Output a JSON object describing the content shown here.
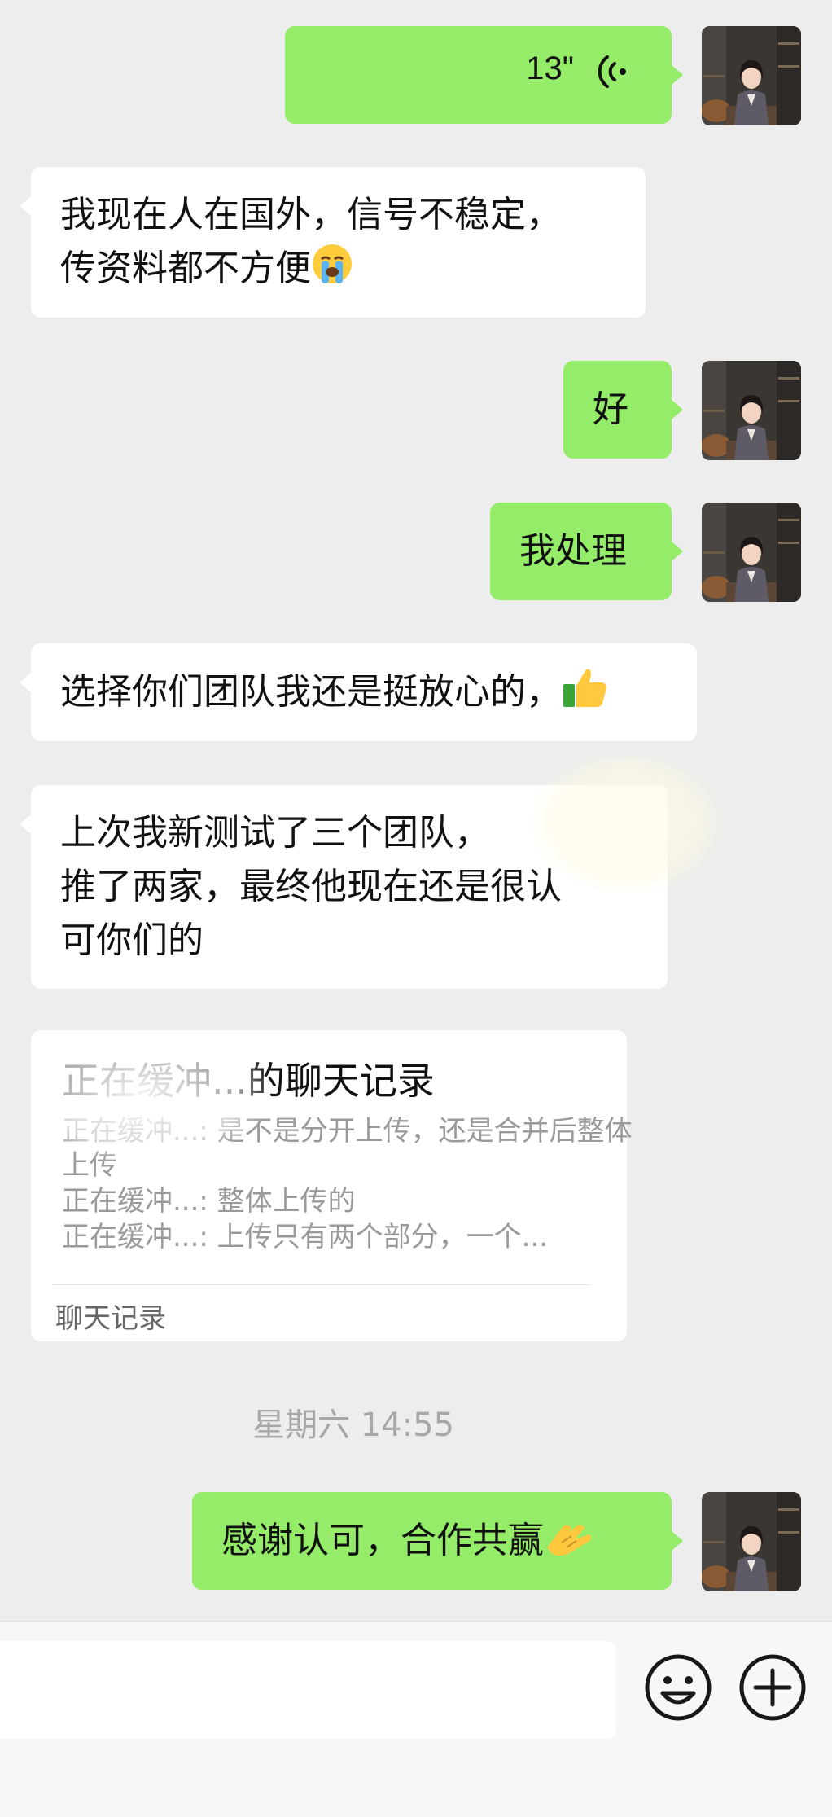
{
  "messages": {
    "voice": {
      "duration": "13\""
    },
    "m1": {
      "line1": "我现在人在国外，信号不稳定，",
      "line2": "传资料都不方便"
    },
    "m2": {
      "text": "好"
    },
    "m3": {
      "text": "我处理"
    },
    "m4": {
      "text": "选择你们团队我还是挺放心的，"
    },
    "m5": {
      "line1": "上次我新测试了三个团队，",
      "line2": "推了两家，最终他现在还是很认",
      "line3": "可你们的"
    },
    "card": {
      "title": "正在缓冲...的聊天记录",
      "lines": [
        "正在缓冲...: 是不是分开上传，还是合并后整体",
        "上传",
        "正在缓冲...: 整体上传的",
        "正在缓冲...: 上传只有两个部分，一个..."
      ],
      "footer": "聊天记录"
    },
    "timestamp": "星期六 14:55",
    "m6": {
      "text": "感谢认可，合作共赢"
    }
  },
  "emojis": {
    "crying": "crying-face-emoji",
    "thumbs_up": "thumbs-up-emoji",
    "handshake": "handshake-emoji"
  },
  "colors": {
    "background": "#ededed",
    "outgoing_bubble": "#95ec69",
    "incoming_bubble": "#ffffff",
    "timestamp": "#a7a7a7"
  },
  "input_bar": {
    "emoji_button_icon": "smiley-icon",
    "more_button_icon": "plus-circle-icon"
  }
}
